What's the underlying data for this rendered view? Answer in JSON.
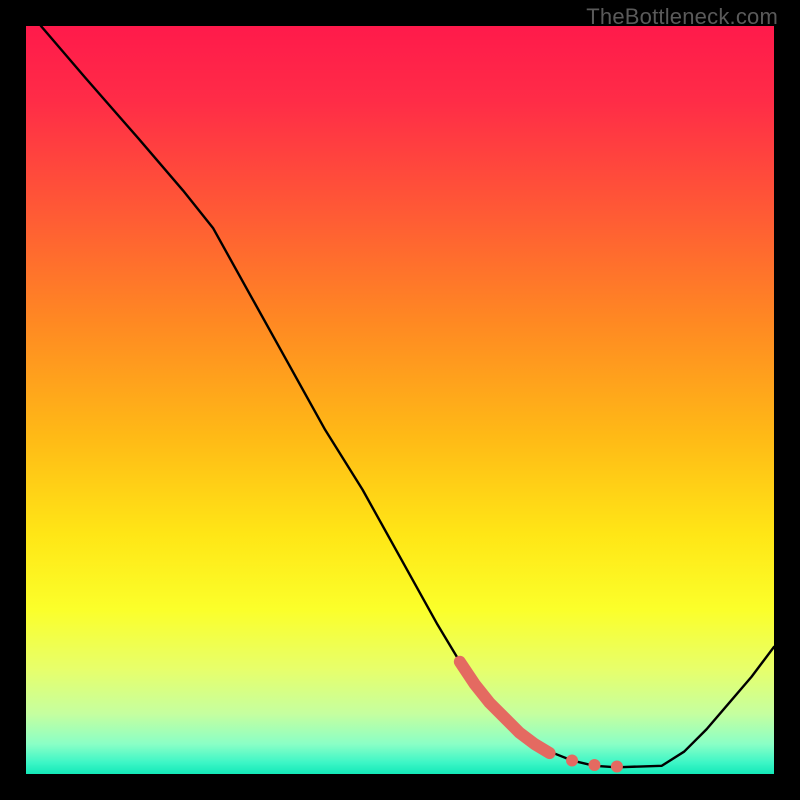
{
  "watermark": "TheBottleneck.com",
  "colors": {
    "gradient_stops": [
      {
        "offset": 0.0,
        "color": "#ff1a4b"
      },
      {
        "offset": 0.1,
        "color": "#ff2c47"
      },
      {
        "offset": 0.25,
        "color": "#ff5a35"
      },
      {
        "offset": 0.4,
        "color": "#ff8a22"
      },
      {
        "offset": 0.55,
        "color": "#ffba16"
      },
      {
        "offset": 0.68,
        "color": "#ffe616"
      },
      {
        "offset": 0.78,
        "color": "#fbff2a"
      },
      {
        "offset": 0.86,
        "color": "#e7ff6b"
      },
      {
        "offset": 0.92,
        "color": "#c5ffa0"
      },
      {
        "offset": 0.96,
        "color": "#8affc6"
      },
      {
        "offset": 0.985,
        "color": "#3cf6c6"
      },
      {
        "offset": 1.0,
        "color": "#13e8b8"
      }
    ],
    "line": "#000000",
    "marker": "#e46a61",
    "frame": "#000000"
  },
  "chart_data": {
    "type": "line",
    "title": "",
    "xlabel": "",
    "ylabel": "",
    "xlim": [
      0,
      100
    ],
    "ylim": [
      0,
      100
    ],
    "series": [
      {
        "name": "curve",
        "x": [
          2,
          8,
          15,
          21,
          25,
          30,
          35,
          40,
          45,
          50,
          55,
          58,
          61,
          64,
          67,
          70,
          73,
          76,
          79,
          82,
          85,
          88,
          91,
          94,
          97,
          100
        ],
        "y": [
          100,
          93,
          85,
          78,
          73,
          64,
          55,
          46,
          38,
          29,
          20,
          15,
          11,
          7.5,
          5,
          3,
          1.8,
          1.1,
          0.9,
          1.0,
          1.1,
          3,
          6,
          9.5,
          13,
          17
        ]
      }
    ],
    "markers": {
      "name": "highlight-segment",
      "points": [
        {
          "x": 58,
          "y": 15
        },
        {
          "x": 60,
          "y": 12
        },
        {
          "x": 62,
          "y": 9.5
        },
        {
          "x": 64,
          "y": 7.5
        },
        {
          "x": 66,
          "y": 5.5
        },
        {
          "x": 68,
          "y": 4
        },
        {
          "x": 70,
          "y": 2.8
        },
        {
          "x": 73,
          "y": 1.8
        },
        {
          "x": 76,
          "y": 1.2
        },
        {
          "x": 79,
          "y": 1.0
        }
      ],
      "radius": 6
    }
  }
}
